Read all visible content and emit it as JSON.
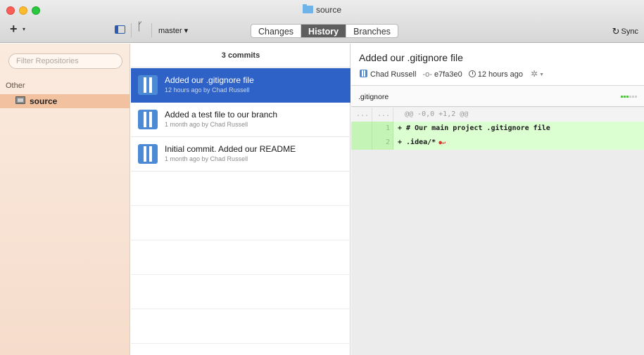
{
  "window": {
    "title": "source"
  },
  "toolbar": {
    "add_label": "+",
    "branch": "master",
    "segments": [
      {
        "label": "Changes",
        "active": false
      },
      {
        "label": "History",
        "active": true
      },
      {
        "label": "Branches",
        "active": false
      }
    ],
    "sync_label": "Sync"
  },
  "sidebar": {
    "filter_placeholder": "Filter Repositories",
    "group": "Other",
    "repo": "source",
    "accent": "#f2c2a0"
  },
  "commits": {
    "header": "3 commits",
    "items": [
      {
        "title": "Added our .gitignore file",
        "meta": "12 hours ago by Chad Russell",
        "selected": true
      },
      {
        "title": "Added a test file to our branch",
        "meta": "1 month ago by Chad Russell",
        "selected": false
      },
      {
        "title": "Initial commit. Added our README",
        "meta": "1 month ago by Chad Russell",
        "selected": false
      }
    ],
    "selected_color": "#2f62c6"
  },
  "detail": {
    "title": "Added our .gitignore file",
    "author": "Chad Russell",
    "sha": "e7fa3e0",
    "time": "12 hours ago",
    "file": ".gitignore",
    "diff": {
      "hunk": {
        "old": "...",
        "new": "...",
        "text": "@@ -0,0 +1,2 @@"
      },
      "lines": [
        {
          "num": "1",
          "text": "+ # Our main project .gitignore file"
        },
        {
          "num": "2",
          "text": "+ .idea/*"
        }
      ]
    }
  }
}
